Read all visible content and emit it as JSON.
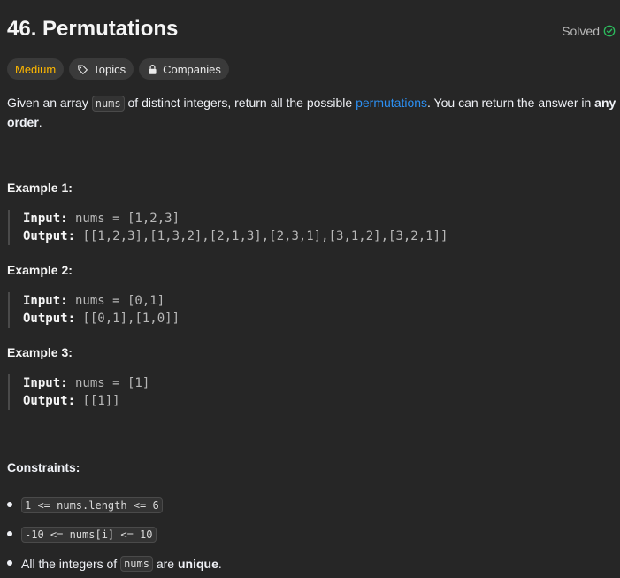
{
  "problem": {
    "title": "46. Permutations",
    "solved_label": "Solved",
    "difficulty": "Medium",
    "topics_label": "Topics",
    "companies_label": "Companies"
  },
  "description": {
    "part1": "Given an array ",
    "code1": "nums",
    "part2": " of distinct integers, return all the possible ",
    "link": "permutations",
    "part3": ". You can return the answer in ",
    "bold1": "any order",
    "part4": "."
  },
  "examples": [
    {
      "title": "Example 1:",
      "input_label": "Input:",
      "input_value": " nums = [1,2,3]",
      "output_label": "Output:",
      "output_value": " [[1,2,3],[1,3,2],[2,1,3],[2,3,1],[3,1,2],[3,2,1]]"
    },
    {
      "title": "Example 2:",
      "input_label": "Input:",
      "input_value": " nums = [0,1]",
      "output_label": "Output:",
      "output_value": " [[0,1],[1,0]]"
    },
    {
      "title": "Example 3:",
      "input_label": "Input:",
      "input_value": " nums = [1]",
      "output_label": "Output:",
      "output_value": " [[1]]"
    }
  ],
  "constraints": {
    "title": "Constraints:",
    "item1_code": "1 <= nums.length <= 6",
    "item2_code": "-10 <= nums[i] <= 10",
    "item3_part1": "All the integers of ",
    "item3_code": "nums",
    "item3_part2": " are ",
    "item3_bold": "unique",
    "item3_part3": "."
  },
  "colors": {
    "background": "#262626",
    "medium": "#ffb800",
    "link": "#2c8ff2",
    "solved_check": "#2cbb5d"
  }
}
